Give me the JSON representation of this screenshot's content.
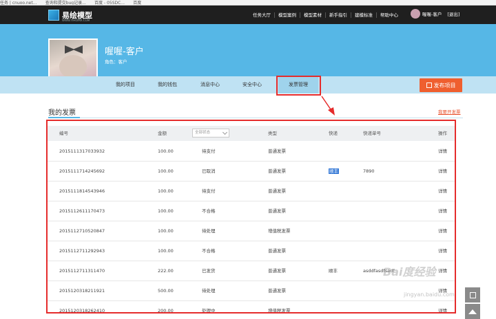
{
  "browser": {
    "bookmarks": [
      "任务 | cnuoo.net...",
      "查询和提交bug记录...",
      "百度 - 05SDC...",
      "百度"
    ]
  },
  "topnav": {
    "logo_text": "易绘模型",
    "logo_sub": "WWW.YIHUIMX.COM",
    "links": [
      "任务大厅",
      "模型案例",
      "模型素材",
      "新手指引",
      "建模标准",
      "帮助中心"
    ],
    "user_name": "喔喔-客户",
    "logout": "[退出]"
  },
  "profile": {
    "name": "喔喔-客户",
    "role": "角色：客户"
  },
  "tabs": [
    {
      "label": "我的项目"
    },
    {
      "label": "我的钱包"
    },
    {
      "label": "消息中心"
    },
    {
      "label": "安全中心"
    },
    {
      "label": "发票管理"
    }
  ],
  "publish_button": "发布项目",
  "section": {
    "title": "我的发票",
    "apply_link": "我要开发票"
  },
  "table": {
    "headers": {
      "number": "编号",
      "amount": "金额",
      "status_filter": "全部状态",
      "type": "类型",
      "express": "快递",
      "tracking": "快递单号",
      "action": "操作"
    },
    "rows": [
      {
        "number": "2015111317033932",
        "amount": "100.00",
        "status": "待支付",
        "type": "普通发票",
        "express": "",
        "tracking": "",
        "action": "详情"
      },
      {
        "number": "2015111714245692",
        "amount": "100.00",
        "status": "已取消",
        "type": "普通发票",
        "express": "顺丰",
        "tracking": "7890",
        "action": "详情"
      },
      {
        "number": "2015111814543946",
        "amount": "100.00",
        "status": "待支付",
        "type": "普通发票",
        "express": "",
        "tracking": "",
        "action": "详情"
      },
      {
        "number": "2015112611170473",
        "amount": "100.00",
        "status": "不合格",
        "type": "普通发票",
        "express": "",
        "tracking": "",
        "action": "详情"
      },
      {
        "number": "2015112710520847",
        "amount": "100.00",
        "status": "待处理",
        "type": "增值税发票",
        "express": "",
        "tracking": "",
        "action": "详情"
      },
      {
        "number": "2015112711292943",
        "amount": "100.00",
        "status": "不合格",
        "type": "普通发票",
        "express": "",
        "tracking": "",
        "action": "详情"
      },
      {
        "number": "2015112711311470",
        "amount": "222.00",
        "status": "已发货",
        "type": "普通发票",
        "express": "顺丰",
        "tracking": "asddfasdfsadf",
        "action": "详情"
      },
      {
        "number": "2015120318211921",
        "amount": "500.00",
        "status": "待处理",
        "type": "普通发票",
        "express": "",
        "tracking": "",
        "action": "详情"
      },
      {
        "number": "2015120318262410",
        "amount": "200.00",
        "status": "处理中",
        "type": "增值税发票",
        "express": "",
        "tracking": "",
        "action": "详情"
      }
    ]
  },
  "watermark": {
    "text": "Bai度经验",
    "url": "jingyan.baidu.com"
  },
  "colors": {
    "nav_bg": "#1f1f1f",
    "banner": "#56b7e6",
    "tabbar": "#bfe2f3",
    "accent": "#ef5f2f",
    "annotation_red": "#e52b2b"
  }
}
